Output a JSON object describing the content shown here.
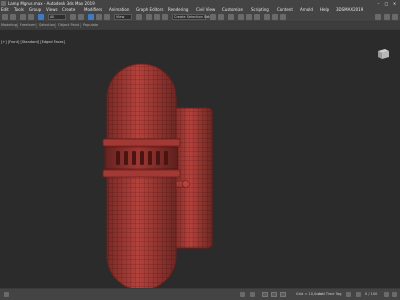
{
  "window": {
    "title": "Lamp Mgrus.max - Autodesk 3ds Max 2019",
    "minimize_glyph": "–",
    "maximize_glyph": "□",
    "close_glyph": "✕"
  },
  "menu": [
    "Edit",
    "Tools",
    "Group",
    "Views",
    "Create",
    "Modifiers",
    "Animation",
    "Graph Editors",
    "Rendering",
    "Civil View",
    "Customize",
    "Scripting",
    "Content",
    "Arnold",
    "Help",
    "3DSMAX2019"
  ],
  "toolbar": {
    "selection_filter": "All",
    "view_dropdown": "View",
    "named_selection": "Create Selection Set"
  },
  "ribbon": {
    "items": [
      "Modeling",
      "Freeform",
      "Selection",
      "Object Paint",
      "Populate"
    ]
  },
  "viewport": {
    "label": "[+] [Front] [Standard] [Edged Faces]",
    "model_color": "#b5423c",
    "wire_color": "#6d1e1b",
    "background": "#2b2b2b"
  },
  "status": {
    "grid": "Grid = 10,0cm",
    "add_time_tag": "Add Time Tag",
    "frame": "0 / 100"
  },
  "colors": {
    "ui_dark": "#444444",
    "accent": "#3e7bc4",
    "viewport_bg": "#2b2b2b"
  }
}
